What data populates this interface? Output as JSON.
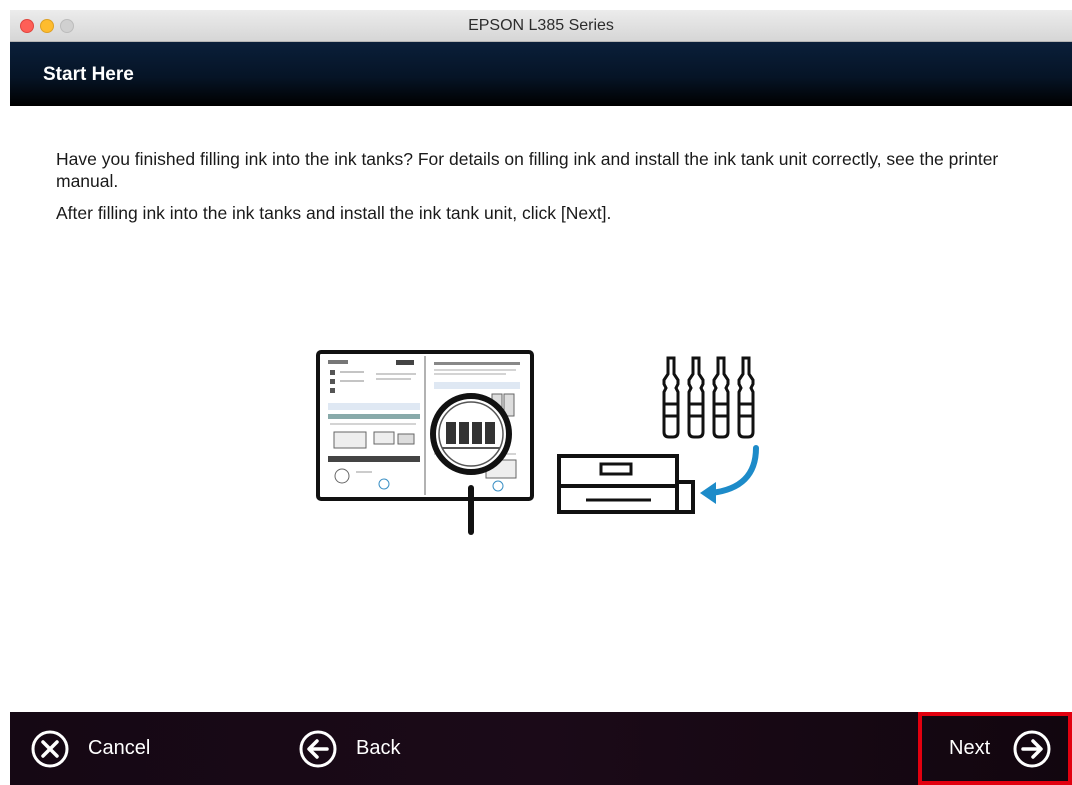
{
  "window": {
    "title": "EPSON L385 Series"
  },
  "header": {
    "title": "Start Here"
  },
  "content": {
    "paragraph1": "Have you finished filling ink into the ink tanks? For details on filling ink and install the ink tank unit correctly, see the printer manual.",
    "paragraph2": "After filling ink into the ink tanks and install the ink tank unit, click [Next]."
  },
  "footer": {
    "cancel_label": "Cancel",
    "back_label": "Back",
    "next_label": "Next"
  },
  "colors": {
    "header_bg": "#061426",
    "footer_bg": "#1b0a18",
    "highlight_border": "#e2000f",
    "arrow_accent": "#1d8bc9"
  },
  "icons": {
    "cancel": "x-circle-icon",
    "back": "arrow-left-circle-icon",
    "next": "arrow-right-circle-icon"
  }
}
